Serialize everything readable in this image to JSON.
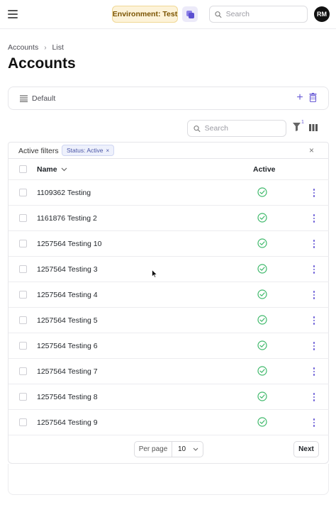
{
  "topbar": {
    "environment_badge": "Environment: Test",
    "search_placeholder": "Search",
    "avatar_initials": "RM"
  },
  "breadcrumb": {
    "items": [
      "Accounts",
      "List"
    ]
  },
  "page_title": "Accounts",
  "view": {
    "label": "Default"
  },
  "table_toolbar": {
    "search_placeholder": "Search",
    "filter_count": "1"
  },
  "active_filters": {
    "label": "Active filters",
    "chips": [
      "Status: Active"
    ]
  },
  "table": {
    "columns": [
      "Name",
      "Active"
    ],
    "rows": [
      {
        "name": "1109362 Testing",
        "active": true
      },
      {
        "name": "1161876 Testing 2",
        "active": true
      },
      {
        "name": "1257564 Testing 10",
        "active": true
      },
      {
        "name": "1257564 Testing 3",
        "active": true
      },
      {
        "name": "1257564 Testing 4",
        "active": true
      },
      {
        "name": "1257564 Testing 5",
        "active": true
      },
      {
        "name": "1257564 Testing 6",
        "active": true
      },
      {
        "name": "1257564 Testing 7",
        "active": true
      },
      {
        "name": "1257564 Testing 8",
        "active": true
      },
      {
        "name": "1257564 Testing 9",
        "active": true
      }
    ]
  },
  "pagination": {
    "per_page_label": "Per page",
    "per_page_value": "10",
    "next_label": "Next"
  },
  "colors": {
    "accent": "#6a5cd6",
    "active_check": "#3fb96b",
    "env_badge_bg": "#fdf3d9"
  },
  "icons": {
    "menu": "hamburger-icon",
    "switch": "switch-org-icon",
    "search": "search-icon",
    "view": "list-icon",
    "add": "plus-icon",
    "delete": "trash-icon",
    "filter": "filter-icon",
    "columns": "columns-icon",
    "close": "close-icon",
    "sort": "chevron-down-icon",
    "active": "check-circle-icon",
    "row_menu": "kebab-icon"
  }
}
